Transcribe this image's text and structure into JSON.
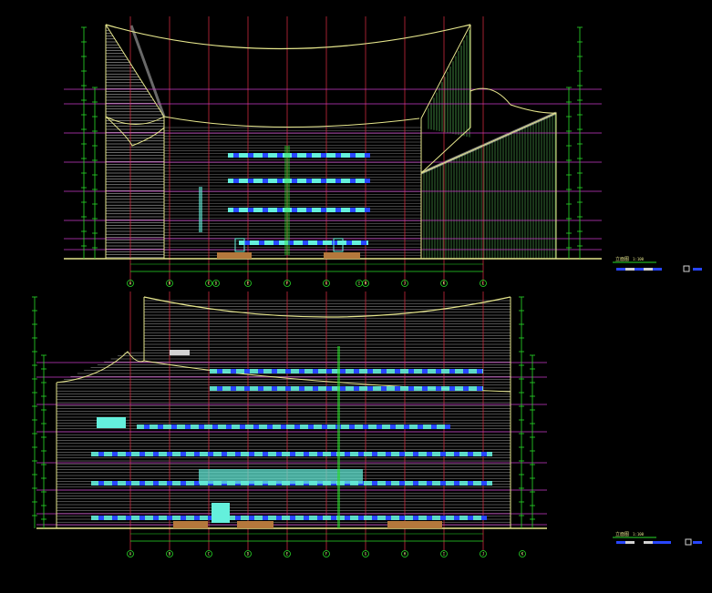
{
  "colors": {
    "background": "#000000",
    "grid_red": "#c8283c",
    "level_magenta": "#c83cc8",
    "outline_yellow": "#e6e68c",
    "facade_lines": "#d2d2d2",
    "dimension_green": "#28dc28",
    "window_cyan": "#64f0dc",
    "window_blue": "#2846ff",
    "ground_brown": "#b4783c",
    "curtain_green": "#78ff78"
  },
  "top_elevation": {
    "title": "立面图",
    "scale": "1:100",
    "axis_labels": [
      "A",
      "B",
      "C",
      "D",
      "E",
      "F",
      "G",
      "H",
      "I",
      "J",
      "K",
      "L"
    ]
  },
  "bottom_elevation": {
    "title": "立面图",
    "scale": "1:100",
    "axis_labels": [
      "A",
      "B",
      "C",
      "D",
      "E",
      "F",
      "G",
      "H",
      "I",
      "J",
      "K"
    ]
  }
}
